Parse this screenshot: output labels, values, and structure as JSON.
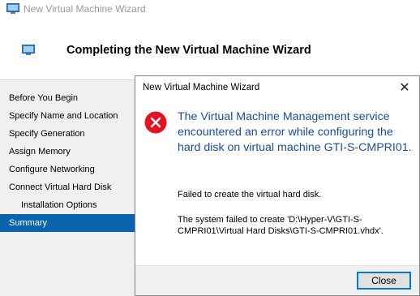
{
  "window": {
    "title": "New Virtual Machine Wizard",
    "heading": "Completing the New Virtual Machine Wizard",
    "icon": "vm-wizard-icon"
  },
  "sidebar": {
    "items": [
      {
        "label": "Before You Begin",
        "active": false,
        "sub": false
      },
      {
        "label": "Specify Name and Location",
        "active": false,
        "sub": false
      },
      {
        "label": "Specify Generation",
        "active": false,
        "sub": false
      },
      {
        "label": "Assign Memory",
        "active": false,
        "sub": false
      },
      {
        "label": "Configure Networking",
        "active": false,
        "sub": false
      },
      {
        "label": "Connect Virtual Hard Disk",
        "active": false,
        "sub": false
      },
      {
        "label": "Installation Options",
        "active": false,
        "sub": true
      },
      {
        "label": "Summary",
        "active": true,
        "sub": false
      }
    ]
  },
  "dialog": {
    "title": "New Virtual Machine Wizard",
    "close_glyph": "✕",
    "icon": "error-icon",
    "heading": "The Virtual Machine Management service encountered an error while configuring the hard disk on virtual machine GTI-S-CMPRI01.",
    "message1": "Failed to create the virtual hard disk.",
    "message2": "The system failed to create 'D:\\Hyper-V\\GTI-S-CMPRI01\\Virtual Hard Disks\\GTI-S-CMPRI01.vhdx'.",
    "close_button": "Close"
  },
  "colors": {
    "accent": "#0a64ad",
    "heading_blue": "#1a4ea3",
    "error_red": "#e81123"
  }
}
